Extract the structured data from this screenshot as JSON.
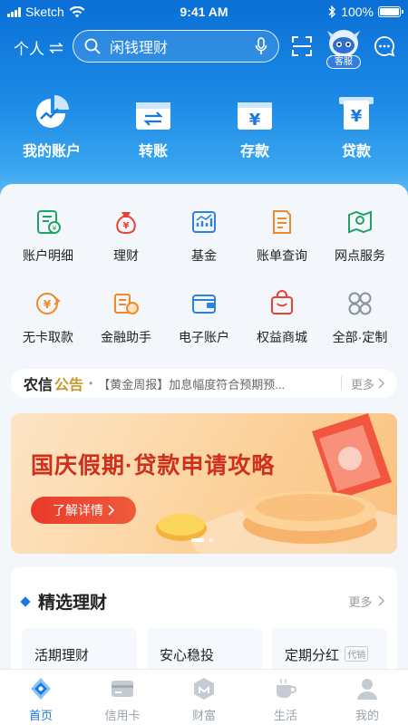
{
  "status_bar": {
    "carrier": "Sketch",
    "time": "9:41 AM",
    "battery": "100%"
  },
  "header": {
    "persona": "个人",
    "search_placeholder": "闲钱理财",
    "service_label": "客服"
  },
  "quick_actions": [
    {
      "label": "我的账户",
      "icon": "account-pie-icon"
    },
    {
      "label": "转账",
      "icon": "transfer-icon"
    },
    {
      "label": "存款",
      "icon": "deposit-icon"
    },
    {
      "label": "贷款",
      "icon": "loan-icon"
    }
  ],
  "services": [
    {
      "label": "账户明细",
      "icon": "account-detail-icon"
    },
    {
      "label": "理财",
      "icon": "money-bag-icon"
    },
    {
      "label": "基金",
      "icon": "fund-chart-icon"
    },
    {
      "label": "账单查询",
      "icon": "bill-query-icon"
    },
    {
      "label": "网点服务",
      "icon": "branch-map-icon"
    },
    {
      "label": "无卡取款",
      "icon": "cardless-withdraw-icon"
    },
    {
      "label": "金融助手",
      "icon": "finance-assistant-icon"
    },
    {
      "label": "电子账户",
      "icon": "e-wallet-icon"
    },
    {
      "label": "权益商城",
      "icon": "shop-bag-icon"
    },
    {
      "label": "全部·定制",
      "icon": "all-grid-icon"
    }
  ],
  "notice": {
    "brand_a": "农信",
    "brand_b": "公告",
    "message": "【黄金周报】加息幅度符合预期预...",
    "more": "更多"
  },
  "banner": {
    "title": "国庆假期·贷款申请攻略",
    "cta": "了解详情",
    "slide_count": 2,
    "active_slide": 1
  },
  "picks": {
    "title": "精选理财",
    "more": "更多",
    "products": [
      {
        "name": "活期理财",
        "tag": ""
      },
      {
        "name": "安心稳投",
        "tag": ""
      },
      {
        "name": "定期分红",
        "tag": "代销"
      }
    ]
  },
  "tabs": [
    {
      "label": "首页",
      "icon": "home-icon",
      "active": true
    },
    {
      "label": "信用卡",
      "icon": "credit-card-icon",
      "active": false
    },
    {
      "label": "财富",
      "icon": "wealth-icon",
      "active": false
    },
    {
      "label": "生活",
      "icon": "life-cup-icon",
      "active": false
    },
    {
      "label": "我的",
      "icon": "profile-icon",
      "active": false
    }
  ],
  "colors": {
    "primary": "#1a78e0",
    "banner_red": "#d0301b",
    "notice_gold": "#c9962a"
  }
}
